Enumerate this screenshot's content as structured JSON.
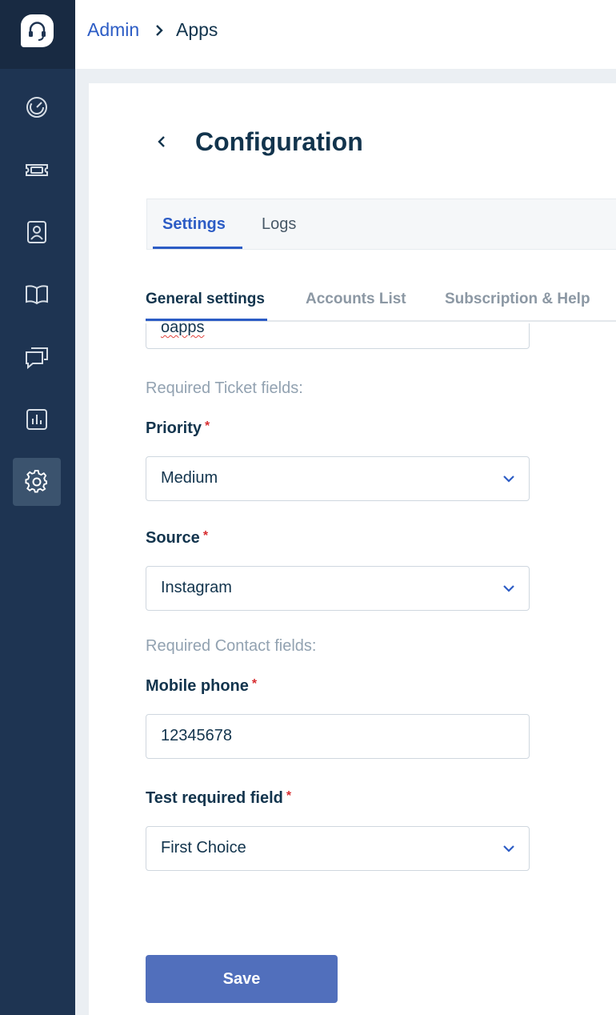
{
  "breadcrumb": {
    "admin": "Admin",
    "apps": "Apps"
  },
  "sidebar": {
    "logo": "freshdesk-logo",
    "items": [
      {
        "icon": "dashboard-icon",
        "active": false
      },
      {
        "icon": "ticket-icon",
        "active": false
      },
      {
        "icon": "contacts-icon",
        "active": false
      },
      {
        "icon": "book-icon",
        "active": false
      },
      {
        "icon": "chat-icon",
        "active": false
      },
      {
        "icon": "reports-icon",
        "active": false
      },
      {
        "icon": "gear-icon",
        "active": true
      }
    ]
  },
  "page": {
    "title": "Configuration"
  },
  "tabs": {
    "settings": "Settings",
    "logs": "Logs"
  },
  "subtabs": {
    "general": "General settings",
    "accounts": "Accounts List",
    "subscription": "Subscription & Help"
  },
  "form": {
    "top_field_value": "oapps",
    "ticket_section": "Required Ticket fields:",
    "priority": {
      "label": "Priority",
      "required": "*",
      "value": "Medium"
    },
    "source": {
      "label": "Source",
      "required": "*",
      "value": "Instagram"
    },
    "contact_section": "Required Contact fields:",
    "mobile_phone": {
      "label": "Mobile phone",
      "required": "*",
      "value": "12345678"
    },
    "test_field": {
      "label": "Test required field",
      "required": "*",
      "value": "First Choice"
    },
    "save_label": "Save"
  },
  "colors": {
    "sidebar": "#1e3452",
    "accent": "#2c5cc5",
    "save_button": "#516fbc",
    "required": "#d72d30"
  }
}
